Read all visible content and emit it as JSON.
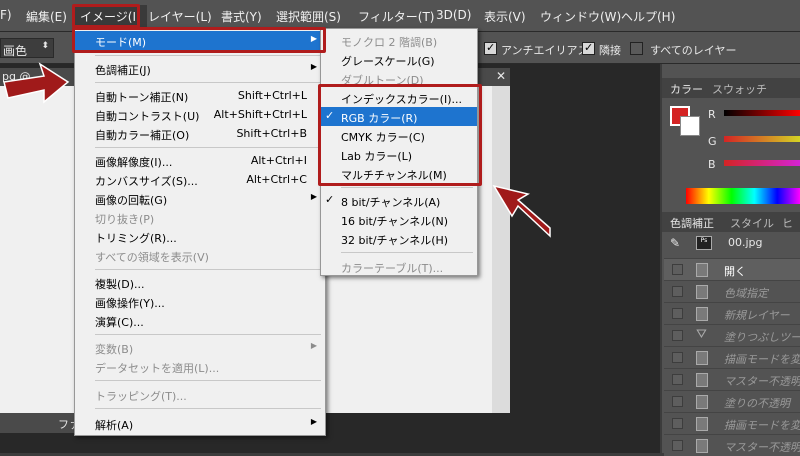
{
  "menubar": {
    "items": [
      "F)",
      "編集(E)",
      "イメージ(I)",
      "レイヤー(L)",
      "書式(Y)",
      "選択範囲(S)",
      "フィルター(T)",
      "3D(D)",
      "表示(V)",
      "ウィンドウ(W)",
      "ヘルプ(H)"
    ]
  },
  "options": {
    "mode_value": "画色",
    "antialias": "アンチエイリアス",
    "adjacent": "隣接",
    "all_layers": "すべてのレイヤー"
  },
  "doc": {
    "tab_partial": "pg @",
    "status_partial": "ファ"
  },
  "image_menu": {
    "items": [
      {
        "label": "モード(M)"
      },
      {
        "label": "色調補正(J)"
      },
      {
        "label": "自動トーン補正(N)",
        "shortcut": "Shift+Ctrl+L"
      },
      {
        "label": "自動コントラスト(U)",
        "shortcut": "Alt+Shift+Ctrl+L"
      },
      {
        "label": "自動カラー補正(O)",
        "shortcut": "Shift+Ctrl+B"
      },
      {
        "label": "画像解像度(I)...",
        "shortcut": "Alt+Ctrl+I"
      },
      {
        "label": "カンバスサイズ(S)...",
        "shortcut": "Alt+Ctrl+C"
      },
      {
        "label": "画像の回転(G)"
      },
      {
        "label": "切り抜き(P)"
      },
      {
        "label": "トリミング(R)..."
      },
      {
        "label": "すべての領域を表示(V)"
      },
      {
        "label": "複製(D)..."
      },
      {
        "label": "画像操作(Y)..."
      },
      {
        "label": "演算(C)..."
      },
      {
        "label": "変数(B)"
      },
      {
        "label": "データセットを適用(L)..."
      },
      {
        "label": "トラッピング(T)..."
      },
      {
        "label": "解析(A)"
      }
    ]
  },
  "mode_submenu": {
    "items": [
      {
        "label": "モノクロ 2 階調(B)"
      },
      {
        "label": "グレースケール(G)"
      },
      {
        "label": "ダブルトーン(D)"
      },
      {
        "label": "インデックスカラー(I)..."
      },
      {
        "label": "RGB カラー(R)"
      },
      {
        "label": "CMYK カラー(C)"
      },
      {
        "label": "Lab カラー(L)"
      },
      {
        "label": "マルチチャンネル(M)"
      },
      {
        "label": "8 bit/チャンネル(A)"
      },
      {
        "label": "16 bit/チャンネル(N)"
      },
      {
        "label": "32 bit/チャンネル(H)"
      },
      {
        "label": "カラーテーブル(T)..."
      }
    ]
  },
  "color_panel": {
    "tabs": [
      "カラー",
      "スウォッチ"
    ],
    "channels": [
      "R",
      "G",
      "B"
    ],
    "foreground": "#d42424"
  },
  "adjust_panel": {
    "tabs": [
      "色調補正",
      "スタイル",
      "ヒ"
    ]
  },
  "history": {
    "doc_name": "00.jpg",
    "items": [
      "開く",
      "色域指定",
      "新規レイヤー",
      "塗りつぶしツール",
      "描画モードを変",
      "マスター不透明",
      "塗りの不透明",
      "描画モードを変",
      "マスター不透明"
    ]
  },
  "colors": {
    "accent": "#1e74cf",
    "annotation": "#b01c1c"
  }
}
